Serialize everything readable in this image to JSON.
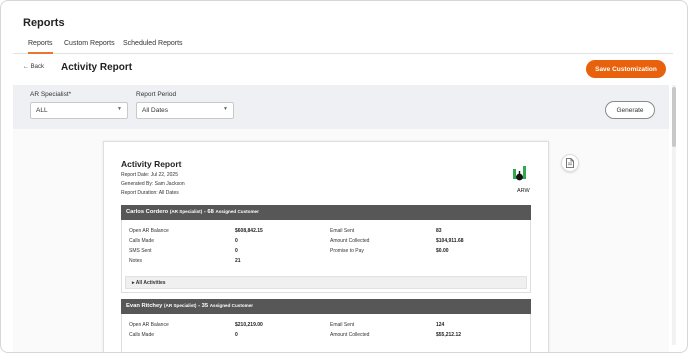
{
  "app": {
    "title": "Reports"
  },
  "tabs": [
    {
      "label": "Reports",
      "active": true
    },
    {
      "label": "Custom Reports",
      "active": false
    },
    {
      "label": "Scheduled Reports",
      "active": false
    }
  ],
  "header": {
    "back_label": "Back",
    "page_title": "Activity Report",
    "save_label": "Save Customization"
  },
  "filters": {
    "specialist": {
      "label": "AR Specialist*",
      "value": "ALL"
    },
    "period": {
      "label": "Report Period",
      "value": "All Dates"
    },
    "generate_label": "Generate"
  },
  "report": {
    "title": "Activity Report",
    "date_line": "Report Date: Jul 22, 2025",
    "generated_line": "Generated By: Sam Jackson",
    "duration_line": "Report Duration: All Dates",
    "logo_text": "ARW",
    "sections": [
      {
        "name": "Carlos Cordero",
        "role": "(AR Specialist)",
        "count_text": "- 68",
        "assigned_label": "Assigned Customer",
        "left": [
          {
            "label": "Open AR Balance",
            "value": "$608,842.15"
          },
          {
            "label": "Calls Made",
            "value": "0"
          },
          {
            "label": "SMS Sent",
            "value": "0"
          },
          {
            "label": "Notes",
            "value": "21"
          }
        ],
        "right": [
          {
            "label": "Email Sent",
            "value": "83"
          },
          {
            "label": "Amount Collected",
            "value": "$104,911.68"
          },
          {
            "label": "Promise to Pay",
            "value": "$0.00"
          }
        ],
        "activities_label": "All Activities"
      },
      {
        "name": "Evan Ritchey",
        "role": "(AR Specialist)",
        "count_text": "- 35",
        "assigned_label": "Assigned Customer",
        "left": [
          {
            "label": "Open AR Balance",
            "value": "$210,219.00"
          },
          {
            "label": "Calls Made",
            "value": "0"
          }
        ],
        "right": [
          {
            "label": "Email Sent",
            "value": "124"
          },
          {
            "label": "Amount Collected",
            "value": "$55,212.12"
          }
        ]
      }
    ]
  },
  "colors": {
    "accent": "#e8620d",
    "section_header": "#575757",
    "logo_green": "#2fa84f"
  },
  "icons": {
    "back": "arrow-left-icon",
    "caret": "chevron-down-icon",
    "document": "document-icon",
    "expand": "caret-right-icon"
  }
}
